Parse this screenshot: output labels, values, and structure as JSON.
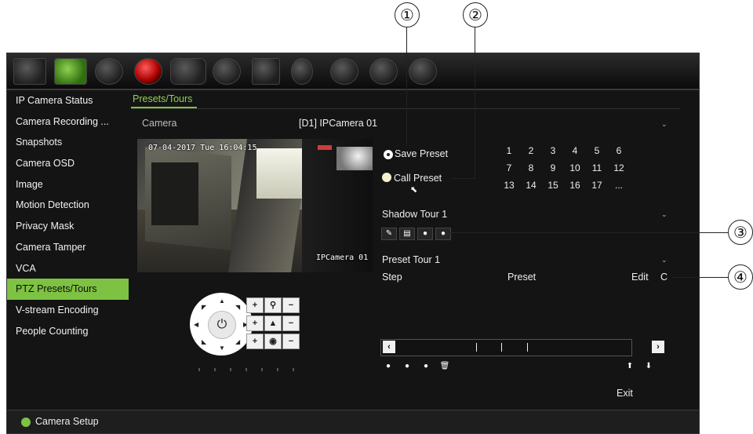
{
  "callouts": [
    "①",
    "②",
    "③",
    "④"
  ],
  "sidebar": {
    "items": [
      {
        "label": "IP Camera Status"
      },
      {
        "label": "Camera Recording ..."
      },
      {
        "label": "Snapshots"
      },
      {
        "label": "Camera OSD"
      },
      {
        "label": "Image"
      },
      {
        "label": "Motion Detection"
      },
      {
        "label": "Privacy Mask"
      },
      {
        "label": "Camera Tamper"
      },
      {
        "label": "VCA"
      },
      {
        "label": "PTZ Presets/Tours"
      },
      {
        "label": "V-stream Encoding"
      },
      {
        "label": "People Counting"
      }
    ],
    "active_index": 9
  },
  "tab": {
    "label": "Presets/Tours"
  },
  "camera": {
    "label": "Camera",
    "value": "[D1] IPCamera 01"
  },
  "video": {
    "timestamp": "07-04-2017 Tue 16:04:15",
    "name": "IPCamera 01"
  },
  "preset_mode": {
    "save_label": "Save Preset",
    "call_label": "Call Preset",
    "selected": "save"
  },
  "preset_numbers": [
    "1",
    "2",
    "3",
    "4",
    "5",
    "6",
    "7",
    "8",
    "9",
    "10",
    "11",
    "12",
    "13",
    "14",
    "15",
    "16",
    "17",
    "..."
  ],
  "shadow_tour": {
    "value": "Shadow Tour 1"
  },
  "preset_tour": {
    "value": "Preset Tour 1"
  },
  "table": {
    "col_step": "Step",
    "col_preset": "Preset",
    "col_edit": "Edit",
    "col_c": "C"
  },
  "exit_label": "Exit",
  "status": {
    "label": "Camera Setup"
  },
  "colors": {
    "accent": "#7dc242",
    "background": "#141414",
    "text": "#eeeeee"
  }
}
